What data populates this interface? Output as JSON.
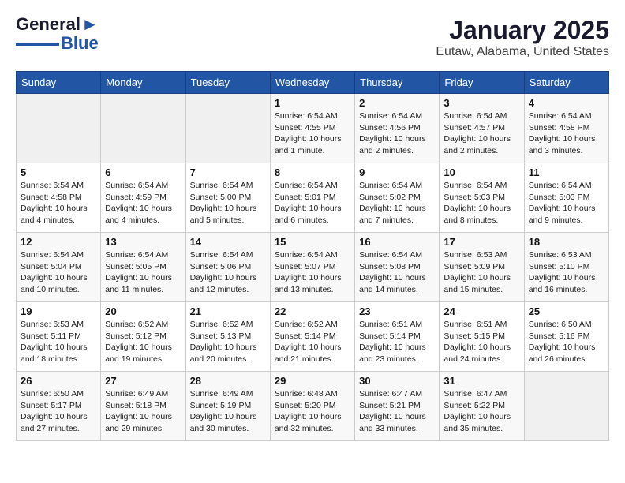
{
  "header": {
    "logo_line1": "General",
    "logo_line2": "Blue",
    "title": "January 2025",
    "subtitle": "Eutaw, Alabama, United States"
  },
  "days_of_week": [
    "Sunday",
    "Monday",
    "Tuesday",
    "Wednesday",
    "Thursday",
    "Friday",
    "Saturday"
  ],
  "weeks": [
    [
      {
        "num": "",
        "info": ""
      },
      {
        "num": "",
        "info": ""
      },
      {
        "num": "",
        "info": ""
      },
      {
        "num": "1",
        "info": "Sunrise: 6:54 AM\nSunset: 4:55 PM\nDaylight: 10 hours\nand 1 minute."
      },
      {
        "num": "2",
        "info": "Sunrise: 6:54 AM\nSunset: 4:56 PM\nDaylight: 10 hours\nand 2 minutes."
      },
      {
        "num": "3",
        "info": "Sunrise: 6:54 AM\nSunset: 4:57 PM\nDaylight: 10 hours\nand 2 minutes."
      },
      {
        "num": "4",
        "info": "Sunrise: 6:54 AM\nSunset: 4:58 PM\nDaylight: 10 hours\nand 3 minutes."
      }
    ],
    [
      {
        "num": "5",
        "info": "Sunrise: 6:54 AM\nSunset: 4:58 PM\nDaylight: 10 hours\nand 4 minutes."
      },
      {
        "num": "6",
        "info": "Sunrise: 6:54 AM\nSunset: 4:59 PM\nDaylight: 10 hours\nand 4 minutes."
      },
      {
        "num": "7",
        "info": "Sunrise: 6:54 AM\nSunset: 5:00 PM\nDaylight: 10 hours\nand 5 minutes."
      },
      {
        "num": "8",
        "info": "Sunrise: 6:54 AM\nSunset: 5:01 PM\nDaylight: 10 hours\nand 6 minutes."
      },
      {
        "num": "9",
        "info": "Sunrise: 6:54 AM\nSunset: 5:02 PM\nDaylight: 10 hours\nand 7 minutes."
      },
      {
        "num": "10",
        "info": "Sunrise: 6:54 AM\nSunset: 5:03 PM\nDaylight: 10 hours\nand 8 minutes."
      },
      {
        "num": "11",
        "info": "Sunrise: 6:54 AM\nSunset: 5:03 PM\nDaylight: 10 hours\nand 9 minutes."
      }
    ],
    [
      {
        "num": "12",
        "info": "Sunrise: 6:54 AM\nSunset: 5:04 PM\nDaylight: 10 hours\nand 10 minutes."
      },
      {
        "num": "13",
        "info": "Sunrise: 6:54 AM\nSunset: 5:05 PM\nDaylight: 10 hours\nand 11 minutes."
      },
      {
        "num": "14",
        "info": "Sunrise: 6:54 AM\nSunset: 5:06 PM\nDaylight: 10 hours\nand 12 minutes."
      },
      {
        "num": "15",
        "info": "Sunrise: 6:54 AM\nSunset: 5:07 PM\nDaylight: 10 hours\nand 13 minutes."
      },
      {
        "num": "16",
        "info": "Sunrise: 6:54 AM\nSunset: 5:08 PM\nDaylight: 10 hours\nand 14 minutes."
      },
      {
        "num": "17",
        "info": "Sunrise: 6:53 AM\nSunset: 5:09 PM\nDaylight: 10 hours\nand 15 minutes."
      },
      {
        "num": "18",
        "info": "Sunrise: 6:53 AM\nSunset: 5:10 PM\nDaylight: 10 hours\nand 16 minutes."
      }
    ],
    [
      {
        "num": "19",
        "info": "Sunrise: 6:53 AM\nSunset: 5:11 PM\nDaylight: 10 hours\nand 18 minutes."
      },
      {
        "num": "20",
        "info": "Sunrise: 6:52 AM\nSunset: 5:12 PM\nDaylight: 10 hours\nand 19 minutes."
      },
      {
        "num": "21",
        "info": "Sunrise: 6:52 AM\nSunset: 5:13 PM\nDaylight: 10 hours\nand 20 minutes."
      },
      {
        "num": "22",
        "info": "Sunrise: 6:52 AM\nSunset: 5:14 PM\nDaylight: 10 hours\nand 21 minutes."
      },
      {
        "num": "23",
        "info": "Sunrise: 6:51 AM\nSunset: 5:14 PM\nDaylight: 10 hours\nand 23 minutes."
      },
      {
        "num": "24",
        "info": "Sunrise: 6:51 AM\nSunset: 5:15 PM\nDaylight: 10 hours\nand 24 minutes."
      },
      {
        "num": "25",
        "info": "Sunrise: 6:50 AM\nSunset: 5:16 PM\nDaylight: 10 hours\nand 26 minutes."
      }
    ],
    [
      {
        "num": "26",
        "info": "Sunrise: 6:50 AM\nSunset: 5:17 PM\nDaylight: 10 hours\nand 27 minutes."
      },
      {
        "num": "27",
        "info": "Sunrise: 6:49 AM\nSunset: 5:18 PM\nDaylight: 10 hours\nand 29 minutes."
      },
      {
        "num": "28",
        "info": "Sunrise: 6:49 AM\nSunset: 5:19 PM\nDaylight: 10 hours\nand 30 minutes."
      },
      {
        "num": "29",
        "info": "Sunrise: 6:48 AM\nSunset: 5:20 PM\nDaylight: 10 hours\nand 32 minutes."
      },
      {
        "num": "30",
        "info": "Sunrise: 6:47 AM\nSunset: 5:21 PM\nDaylight: 10 hours\nand 33 minutes."
      },
      {
        "num": "31",
        "info": "Sunrise: 6:47 AM\nSunset: 5:22 PM\nDaylight: 10 hours\nand 35 minutes."
      },
      {
        "num": "",
        "info": ""
      }
    ]
  ]
}
